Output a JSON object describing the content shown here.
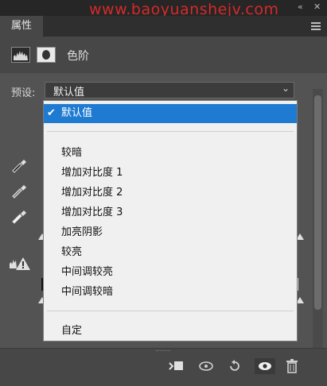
{
  "watermark": "www.baoyuanshejv.com",
  "window_controls": {
    "collapse": "«",
    "close": "✕"
  },
  "tab": {
    "label": "属性"
  },
  "panel": {
    "title": "色阶"
  },
  "preset": {
    "label": "预设:",
    "value": "默认值"
  },
  "dropdown": {
    "items": [
      {
        "label": "默认值",
        "selected": true
      },
      {
        "label": "较暗"
      },
      {
        "label": "增加对比度 1"
      },
      {
        "label": "增加对比度 2"
      },
      {
        "label": "增加对比度 3"
      },
      {
        "label": "加亮阴影"
      },
      {
        "label": "较亮"
      },
      {
        "label": "中间调较亮"
      },
      {
        "label": "中间调较暗"
      },
      {
        "label": "自定"
      }
    ]
  },
  "icons": {
    "adjustment": "levels-histogram-icon",
    "mask": "layer-mask-icon",
    "eyedroppers": [
      "black-point-eyedropper-icon",
      "gray-point-eyedropper-icon",
      "white-point-eyedropper-icon"
    ],
    "warning": "clipping-warning-icon",
    "footer": [
      "clip-to-layer-icon",
      "view-previous-state-icon",
      "reset-icon",
      "visibility-icon",
      "trash-icon"
    ]
  },
  "colors": {
    "selection": "#1f7ad1",
    "watermark": "#d42a2a",
    "panel_bg": "#535353"
  }
}
